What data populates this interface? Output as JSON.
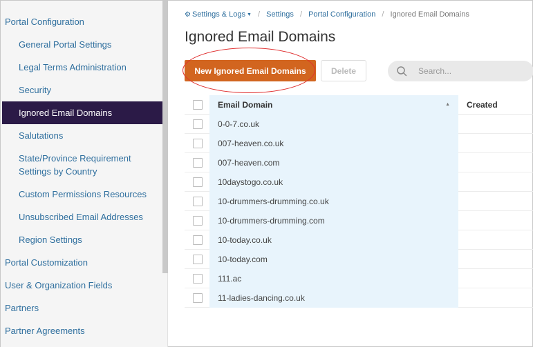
{
  "sidebar": {
    "items": [
      {
        "label": "Portal Configuration",
        "level": "top"
      },
      {
        "label": "General Portal Settings",
        "level": "sub"
      },
      {
        "label": "Legal Terms Administration",
        "level": "sub"
      },
      {
        "label": "Security",
        "level": "sub"
      },
      {
        "label": "Ignored Email Domains",
        "level": "sub",
        "active": true
      },
      {
        "label": "Salutations",
        "level": "sub"
      },
      {
        "label": "State/Province Requirement Settings by Country",
        "level": "sub"
      },
      {
        "label": "Custom Permissions Resources",
        "level": "sub"
      },
      {
        "label": "Unsubscribed Email Addresses",
        "level": "sub"
      },
      {
        "label": "Region Settings",
        "level": "sub"
      },
      {
        "label": "Portal Customization",
        "level": "top"
      },
      {
        "label": "User & Organization Fields",
        "level": "top"
      },
      {
        "label": "Partners",
        "level": "top"
      },
      {
        "label": "Partner Agreements",
        "level": "top"
      }
    ]
  },
  "breadcrumb": {
    "root": "Settings & Logs",
    "items": [
      "Settings",
      "Portal Configuration",
      "Ignored Email Domains"
    ]
  },
  "page": {
    "title": "Ignored Email Domains"
  },
  "toolbar": {
    "new_label": "New Ignored Email Domains",
    "delete_label": "Delete",
    "search_placeholder": "Search..."
  },
  "table": {
    "columns": [
      "Email Domain",
      "Created"
    ],
    "rows": [
      {
        "domain": "0-0-7.co.uk",
        "created": ""
      },
      {
        "domain": "007-heaven.co.uk",
        "created": ""
      },
      {
        "domain": "007-heaven.com",
        "created": ""
      },
      {
        "domain": "10daystogo.co.uk",
        "created": ""
      },
      {
        "domain": "10-drummers-drumming.co.uk",
        "created": ""
      },
      {
        "domain": "10-drummers-drumming.com",
        "created": ""
      },
      {
        "domain": "10-today.co.uk",
        "created": ""
      },
      {
        "domain": "10-today.com",
        "created": ""
      },
      {
        "domain": "111.ac",
        "created": ""
      },
      {
        "domain": "11-ladies-dancing.co.uk",
        "created": ""
      }
    ]
  },
  "colors": {
    "accent": "#d2651f",
    "active_nav": "#2b1a47",
    "link": "#2f6f9e",
    "highlight_column": "#e8f4fc"
  }
}
